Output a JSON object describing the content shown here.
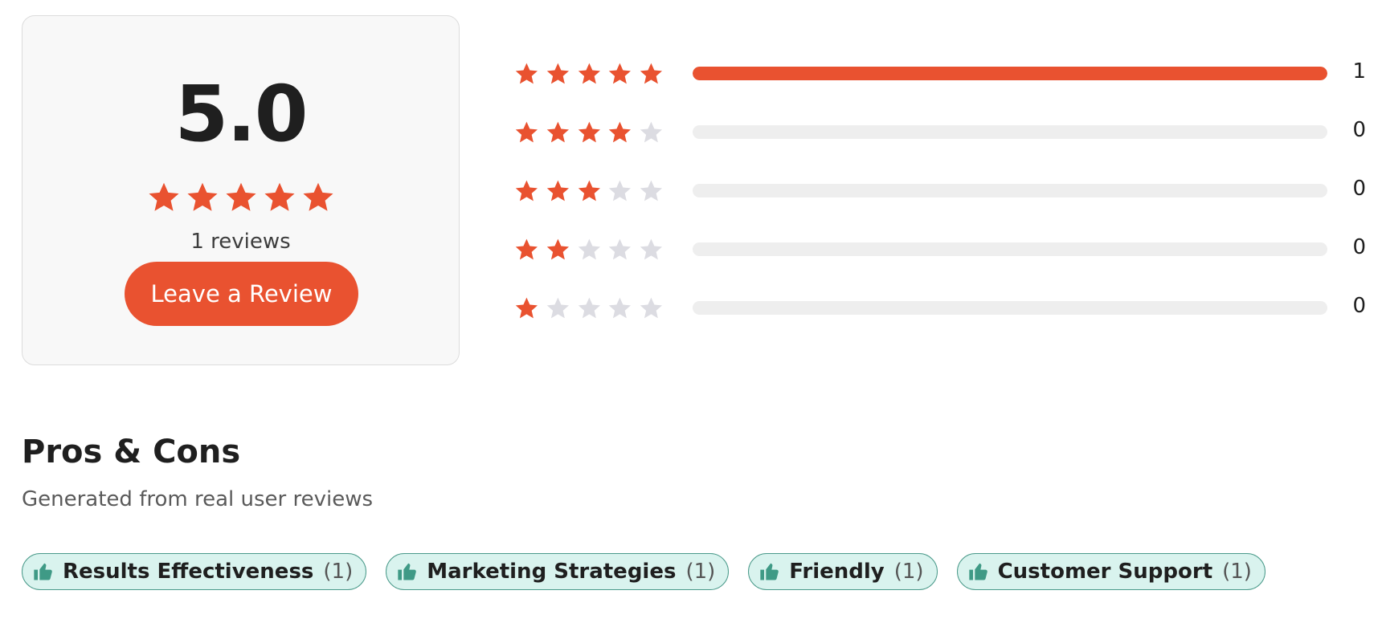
{
  "summary": {
    "score": "5.0",
    "stars_filled": 5,
    "reviews_text": "1 reviews",
    "button_label": "Leave a Review"
  },
  "distribution": [
    {
      "stars": 5,
      "count": "1",
      "fraction": 1.0
    },
    {
      "stars": 4,
      "count": "0",
      "fraction": 0
    },
    {
      "stars": 3,
      "count": "0",
      "fraction": 0
    },
    {
      "stars": 2,
      "count": "0",
      "fraction": 0
    },
    {
      "stars": 1,
      "count": "0",
      "fraction": 0
    }
  ],
  "pros_cons": {
    "title": "Pros & Cons",
    "subtitle": "Generated from real user reviews",
    "tags": [
      {
        "label": "Results Effectiveness",
        "count": "(1)",
        "icon": "thumbs-up-icon"
      },
      {
        "label": "Marketing Strategies",
        "count": "(1)",
        "icon": "thumbs-up-icon"
      },
      {
        "label": "Friendly",
        "count": "(1)",
        "icon": "thumbs-up-icon"
      },
      {
        "label": "Customer Support",
        "count": "(1)",
        "icon": "thumbs-up-icon"
      }
    ]
  },
  "colors": {
    "accent": "#e95230",
    "star_empty": "#dcdce2",
    "tag_bg": "#d9f3ee",
    "tag_icon": "#3f9a86"
  }
}
